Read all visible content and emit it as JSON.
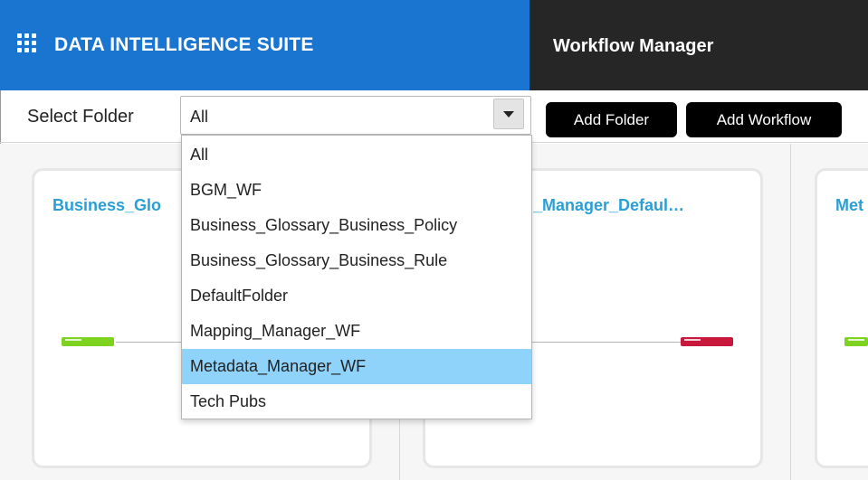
{
  "header": {
    "brand_title": "DATA INTELLIGENCE SUITE",
    "module_title": "Workflow Manager",
    "brand_color": "#1a75d1",
    "module_color": "#262626"
  },
  "toolbar": {
    "select_label": "Select Folder",
    "select_value": "All",
    "add_folder_label": "Add Folder",
    "add_workflow_label": "Add Workflow"
  },
  "dropdown": {
    "options": [
      "All",
      "BGM_WF",
      "Business_Glossary_Business_Policy",
      "Business_Glossary_Business_Rule",
      "DefaultFolder",
      "Mapping_Manager_WF",
      "Metadata_Manager_WF",
      "Tech Pubs"
    ],
    "highlighted": "Metadata_Manager_WF",
    "highlight_color": "#8fd3fb"
  },
  "cards": [
    {
      "title_visible": "Business_Glo",
      "node_start_color": "#7ed321"
    },
    {
      "title_visible": "_Manager_Defaul…",
      "node_end_color": "#c8193c"
    },
    {
      "title_visible": "Met",
      "node_start_color": "#7ed321"
    }
  ],
  "icons": {
    "apps": "apps-grid-icon",
    "dropdown_arrow": "chevron-down-icon"
  }
}
